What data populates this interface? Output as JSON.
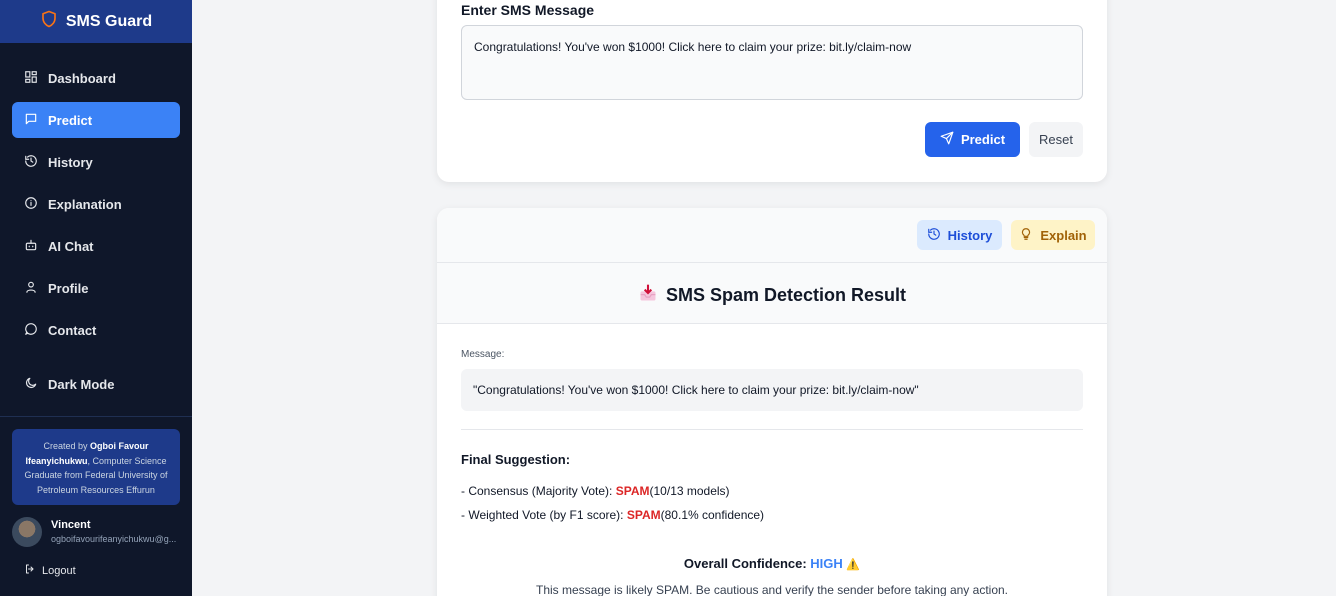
{
  "sidebar": {
    "brand": "SMS Guard",
    "items": [
      {
        "label": "Dashboard",
        "icon": "dashboard-icon"
      },
      {
        "label": "Predict",
        "icon": "message-icon",
        "active": true
      },
      {
        "label": "History",
        "icon": "history-icon"
      },
      {
        "label": "Explanation",
        "icon": "info-icon"
      },
      {
        "label": "AI Chat",
        "icon": "bot-icon"
      },
      {
        "label": "Profile",
        "icon": "user-icon"
      },
      {
        "label": "Contact",
        "icon": "chat-bubble-icon"
      }
    ],
    "dark_mode": "Dark Mode",
    "credit": {
      "prefix": "Created by",
      "author": "Ogboi Favour Ifeanyichukwu",
      "suffix": ", Computer Science Graduate from Federal University of Petroleum Resources Effurun"
    },
    "user": {
      "name": "Vincent",
      "email": "ogboifavourifeanyichukwu@g..."
    },
    "logout": "Logout"
  },
  "input_card": {
    "label": "Enter SMS Message",
    "message": "Congratulations! You've won $1000! Click here to claim your prize: bit.ly/claim-now",
    "predict_label": "Predict",
    "reset_label": "Reset"
  },
  "result": {
    "history_label": "History",
    "explain_label": "Explain",
    "title": "SMS Spam Detection Result",
    "message_label": "Message:",
    "message_quoted": "\"Congratulations! You've won $1000! Click here to claim your prize: bit.ly/claim-now\"",
    "final_title": "Final Suggestion:",
    "consensus_prefix": "- Consensus (Majority Vote): ",
    "consensus_label": "SPAM",
    "consensus_detail": "(10/13 models)",
    "weighted_prefix": "- Weighted Vote (by F1 score): ",
    "weighted_label": "SPAM",
    "weighted_detail": "(80.1% confidence)",
    "overall_prefix": "Overall Confidence: ",
    "overall_level": "HIGH",
    "overall_icon": "⚠️",
    "advice": "This message is likely SPAM. Be cautious and verify the sender before taking any action."
  },
  "colors": {
    "sidebar_bg": "#0f172a",
    "brand_bg": "#1e3a8a",
    "active": "#3b82f6",
    "primary": "#2563eb",
    "spam": "#dc2626",
    "high": "#3b82f6"
  }
}
